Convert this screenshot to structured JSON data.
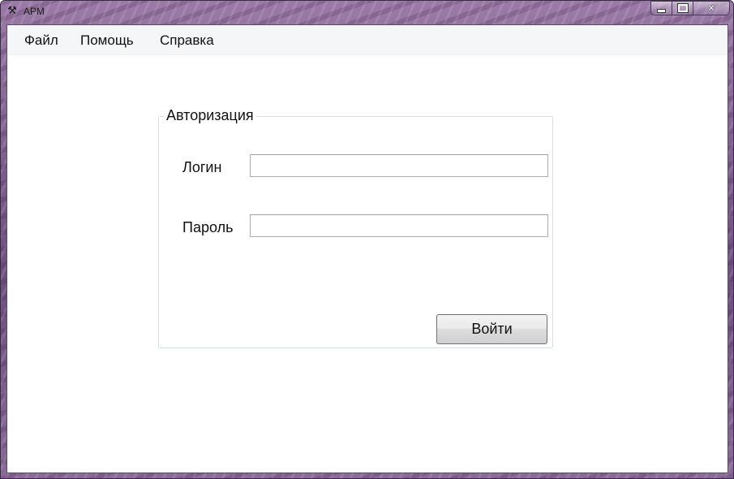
{
  "window": {
    "title": "АРМ",
    "app_icon": "hammer-pick-icon"
  },
  "caption_buttons": {
    "minimize_icon": "minimize-icon",
    "maximize_icon": "maximize-icon",
    "close_icon": "close-icon",
    "close_glyph": "✕"
  },
  "menu": {
    "items": [
      {
        "label": "Файл"
      },
      {
        "label": "Помощь"
      },
      {
        "label": "Справка"
      }
    ]
  },
  "auth": {
    "group_title": "Авторизация",
    "login_label": "Логин",
    "login_value": "",
    "password_label": "Пароль",
    "password_value": "",
    "submit_label": "Войти"
  },
  "colors": {
    "window_frame": "#7d5d8f",
    "client_background": "#ffffff",
    "menubar_background": "#f5f6f7"
  }
}
